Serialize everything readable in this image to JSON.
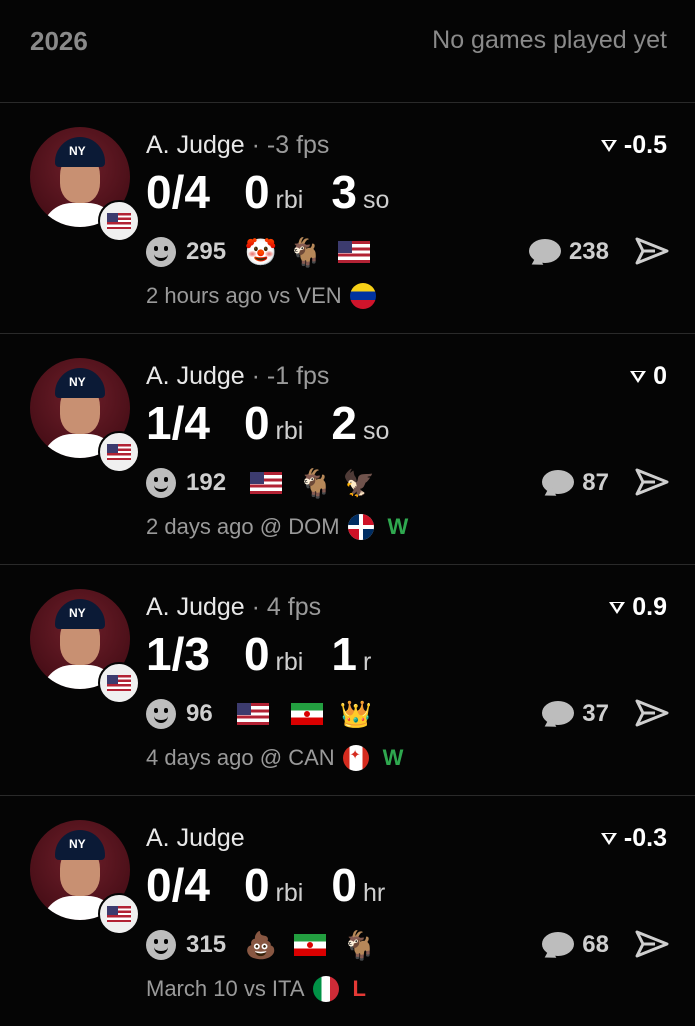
{
  "header": {
    "season": "2026",
    "status": "No games played yet"
  },
  "colors": {
    "win": "#2fa84f",
    "loss": "#e53935",
    "avatar_bg": "#4a0f18"
  },
  "games": [
    {
      "player": "A. Judge",
      "fps": " · -3 fps",
      "rating": "-0.5",
      "stats": [
        {
          "value": "0/4",
          "label": ""
        },
        {
          "value": "0",
          "label": "rbi"
        },
        {
          "value": "3",
          "label": "so"
        }
      ],
      "reaction_count": "295",
      "reactions": [
        "clown-emoji",
        "goat-emoji",
        "us-flag"
      ],
      "comments": "238",
      "when": "2 hours ago vs VEN",
      "opponent_flag": "venezuela-flag",
      "result": ""
    },
    {
      "player": "A. Judge",
      "fps": " · -1 fps",
      "rating": "0",
      "stats": [
        {
          "value": "1/4",
          "label": ""
        },
        {
          "value": "0",
          "label": "rbi"
        },
        {
          "value": "2",
          "label": "so"
        }
      ],
      "reaction_count": "192",
      "reactions": [
        "us-flag",
        "goat-emoji",
        "eagle-emoji"
      ],
      "comments": "87",
      "when": "2 days ago @ DOM",
      "opponent_flag": "dominican-republic-flag",
      "result": "W"
    },
    {
      "player": "A. Judge",
      "fps": " · 4 fps",
      "rating": "0.9",
      "stats": [
        {
          "value": "1/3",
          "label": ""
        },
        {
          "value": "0",
          "label": "rbi"
        },
        {
          "value": "1",
          "label": "r"
        }
      ],
      "reaction_count": "96",
      "reactions": [
        "us-flag",
        "iran-flag",
        "crown-emoji"
      ],
      "comments": "37",
      "when": "4 days ago @ CAN",
      "opponent_flag": "canada-flag",
      "result": "W"
    },
    {
      "player": "A. Judge",
      "fps": "",
      "rating": "-0.3",
      "stats": [
        {
          "value": "0/4",
          "label": ""
        },
        {
          "value": "0",
          "label": "rbi"
        },
        {
          "value": "0",
          "label": "hr"
        }
      ],
      "reaction_count": "315",
      "reactions": [
        "poop-emoji",
        "iran-flag",
        "goat-emoji"
      ],
      "comments": "68",
      "when": "March 10 vs ITA",
      "opponent_flag": "italy-flag",
      "result": "L"
    }
  ]
}
